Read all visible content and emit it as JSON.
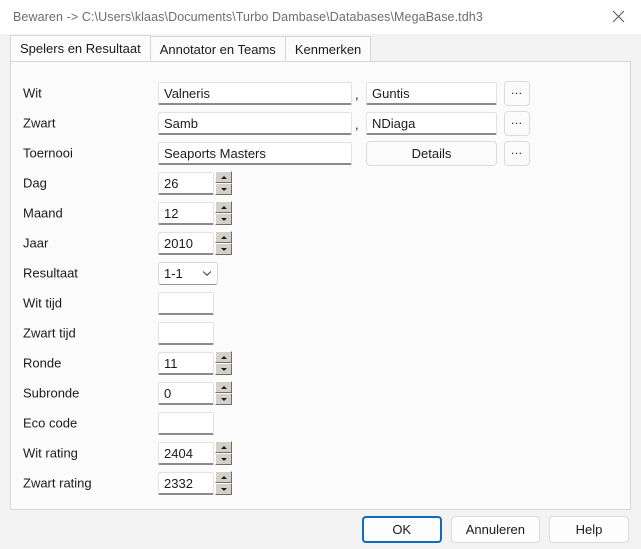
{
  "window": {
    "title": "Bewaren -> C:\\Users\\klaas\\Documents\\Turbo Dambase\\Databases\\MegaBase.tdh3",
    "close_icon": "close-icon"
  },
  "tabs": [
    {
      "label": "Spelers en Resultaat",
      "selected": true
    },
    {
      "label": "Annotator en Teams",
      "selected": false
    },
    {
      "label": "Kenmerken",
      "selected": false
    }
  ],
  "form": {
    "rows": [
      {
        "label": "Wit",
        "value": "Valneris",
        "value2": "Guntis",
        "separator": ",",
        "browse": "…"
      },
      {
        "label": "Zwart",
        "value": "Samb",
        "value2": "NDiaga",
        "separator": ",",
        "browse": "…"
      },
      {
        "label": "Toernooi",
        "value": "Seaports Masters",
        "details": "Details",
        "browse": "…"
      },
      {
        "label": "Dag",
        "value": "26"
      },
      {
        "label": "Maand",
        "value": "12"
      },
      {
        "label": "Jaar",
        "value": "2010"
      },
      {
        "label": "Resultaat",
        "value": "1-1"
      },
      {
        "label": "Wit tijd",
        "value": ""
      },
      {
        "label": "Zwart tijd",
        "value": ""
      },
      {
        "label": "Ronde",
        "value": "11"
      },
      {
        "label": "Subronde",
        "value": "0"
      },
      {
        "label": "Eco code",
        "value": ""
      },
      {
        "label": "Wit rating",
        "value": "2404"
      },
      {
        "label": "Zwart rating",
        "value": "2332"
      }
    ]
  },
  "footer": {
    "ok": "OK",
    "cancel": "Annuleren",
    "help": "Help"
  },
  "colors": {
    "accent": "#0f6cbd",
    "window_bg": "#f3f3f3",
    "panel_bg": "#fbfbfb",
    "field_bg": "#ffffff",
    "title_text": "#6d6d6d"
  }
}
